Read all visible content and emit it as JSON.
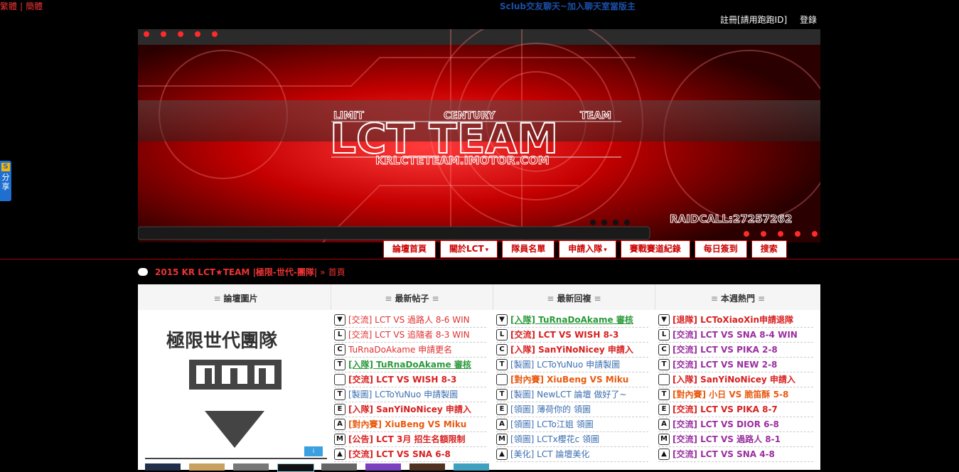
{
  "top": {
    "lang": [
      "繁體",
      "簡體"
    ],
    "marquee": "Sclub交友聊天~加入聊天室當版主",
    "register": "註冊[請用跑跑ID]",
    "login": "登錄"
  },
  "share": {
    "logo": "S",
    "label": "分享"
  },
  "banner": {
    "limit": "LIMIT",
    "century": "CENTURY",
    "team": "TEAM",
    "title": "LCT TEAM",
    "url": "KRLCTETEAM.IMOTOR.COM",
    "raidcall": "RAIDCALL:27257262"
  },
  "nav": [
    {
      "label": "論壇首頁",
      "caret": false
    },
    {
      "label": "關於LCT",
      "caret": true
    },
    {
      "label": "隊員名單",
      "caret": false
    },
    {
      "label": "申請入隊",
      "caret": true
    },
    {
      "label": "賽戰賽道紀錄",
      "caret": false
    },
    {
      "label": "每日簽到",
      "caret": false
    },
    {
      "label": "搜索",
      "caret": false
    }
  ],
  "breadcrumb": {
    "site": "2015 KR LCT★TEAM |極限-世代-團隊|",
    "sep": "»",
    "home": "首頁"
  },
  "panel": {
    "headers": [
      "論壇圖片",
      "最新帖子",
      "最新回複",
      "本週熱門"
    ],
    "header_mark": "≡",
    "image": {
      "logo_text": "極限世代團隊",
      "btn": "i"
    },
    "latest_posts": [
      {
        "icon": "▼",
        "dark": false,
        "text": "[交流] LCT VS 過路人 8-6 WIN",
        "style": "c-red"
      },
      {
        "icon": "L",
        "dark": false,
        "text": "[交流] LCT VS 追隨者 8-3 WIN",
        "style": "c-red"
      },
      {
        "icon": "C",
        "dark": false,
        "text": "TuRnaDoAkame 申請更名",
        "style": "c-red"
      },
      {
        "icon": "T",
        "dark": false,
        "text": "[入隊] TuRnaDoAkame 審核",
        "style": "c-green"
      },
      {
        "icon": "",
        "dark": false,
        "text": "[交流] LCT VS WISH 8-3",
        "style": "c-redb"
      },
      {
        "icon": "T",
        "dark": false,
        "text": "[製圖] LCToYuNuo 申請製圖",
        "style": "c-blue"
      },
      {
        "icon": "E",
        "dark": false,
        "text": "[入隊] SanYiNoNicey 申請入",
        "style": "c-redb"
      },
      {
        "icon": "A",
        "dark": false,
        "text": "[對內賽] XiuBeng VS Miku",
        "style": "c-orange"
      },
      {
        "icon": "M",
        "dark": false,
        "text": "[公告] LCT 3月 招生名額限制",
        "style": "c-redb"
      },
      {
        "icon": "▲",
        "dark": false,
        "text": "[交流] LCT VS SNA 6-8",
        "style": "c-redb"
      }
    ],
    "latest_replies": [
      {
        "icon": "▼",
        "text": "[入隊] TuRnaDoAkame 審核",
        "style": "c-green"
      },
      {
        "icon": "L",
        "text": "[交流] LCT VS WISH 8-3",
        "style": "c-redb"
      },
      {
        "icon": "C",
        "text": "[入隊] SanYiNoNicey 申請入",
        "style": "c-redb"
      },
      {
        "icon": "T",
        "text": "[製圖] LCToYuNuo 申請製圖",
        "style": "c-blue"
      },
      {
        "icon": "",
        "text": "[對內賽] XiuBeng VS Miku",
        "style": "c-orange"
      },
      {
        "icon": "T",
        "text": "[製圖] NewLCT 論壇 做好了~",
        "style": "c-blue"
      },
      {
        "icon": "E",
        "text": "[領圖] 薄荷你的 領圖",
        "style": "c-blue"
      },
      {
        "icon": "A",
        "text": "[領圖] LCTo江姐 領圖",
        "style": "c-blue"
      },
      {
        "icon": "M",
        "text": "[領圖] LCTx櫻花c 領圖",
        "style": "c-blue"
      },
      {
        "icon": "▲",
        "text": "[美化] LCT 論壇美化",
        "style": "c-blue"
      }
    ],
    "weekly_hot": [
      {
        "icon": "▼",
        "text": "[退隊] LCToXiaoXin申請退隊",
        "style": "c-redb"
      },
      {
        "icon": "L",
        "text": "[交流] LCT VS SNA 8-4 WIN",
        "style": "c-purple"
      },
      {
        "icon": "C",
        "text": "[交流] LCT VS PIKA 2-8",
        "style": "c-purple"
      },
      {
        "icon": "T",
        "text": "[交流] LCT VS NEW 2-8",
        "style": "c-purple"
      },
      {
        "icon": "",
        "text": "[入隊] SanYiNoNicey 申請入",
        "style": "c-redb"
      },
      {
        "icon": "T",
        "text": "[對內賽] 小日 VS 脆笛酥 5-8",
        "style": "c-orange"
      },
      {
        "icon": "E",
        "text": "[交流] LCT VS PIKA 8-7",
        "style": "c-redb"
      },
      {
        "icon": "A",
        "text": "[交流] LCT VS DIOR 6-8",
        "style": "c-purple"
      },
      {
        "icon": "M",
        "text": "[交流] LCT VS 過路人 8-1",
        "style": "c-purple"
      },
      {
        "icon": "▲",
        "text": "[交流] LCT VS SNA 4-8",
        "style": "c-purple"
      }
    ]
  },
  "colors": {
    "accent": "#e33333",
    "nav_border": "#cc0000",
    "background": "#000000"
  }
}
